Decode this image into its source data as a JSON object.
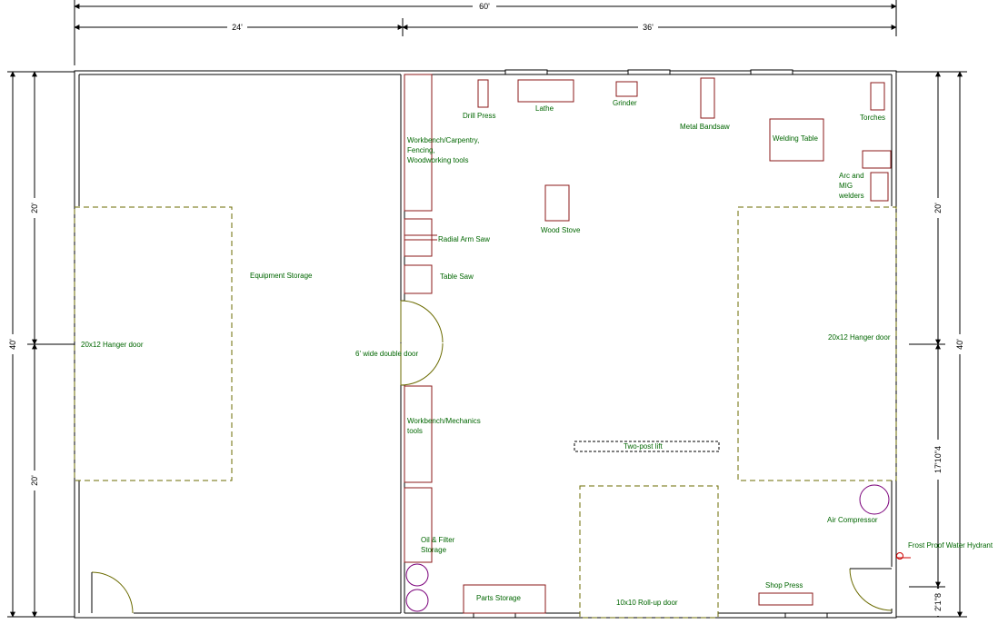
{
  "colors": {
    "wall": "#000000",
    "equipment": "#8b1a1a",
    "label": "#006600",
    "door": "#6b6b00",
    "hanger_dash": "#6b6b00",
    "circle": "#7a007a",
    "hydrant": "#cc0000"
  },
  "dimensions": {
    "total_width": "60'",
    "left_width": "24'",
    "right_width": "36'",
    "left_top_height": "20'",
    "left_total_height": "40'",
    "left_bottom_height": "20'",
    "right_top_height": "20'",
    "right_total_height": "40'",
    "right_mid_height": "17'10\"4",
    "right_bottom_height": "2'1\"8"
  },
  "labels": {
    "drill_press": "Drill Press",
    "lathe": "Lathe",
    "grinder": "Grinder",
    "metal_bandsaw": "Metal Bandsaw",
    "torches": "Torches",
    "welding_table": "Welding Table",
    "arc_mig": [
      "Arc and",
      "MIG",
      "welders"
    ],
    "workbench_carpentry": [
      "Workbench/Carpentry,",
      "Fencing,",
      "Woodworking tools"
    ],
    "radial_arm_saw": "Radial Arm Saw",
    "table_saw": "Table Saw",
    "wood_stove": "Wood Stove",
    "equipment_storage": "Equipment Storage",
    "left_hanger_door": "20x12 Hanger door",
    "right_hanger_door": "20x12 Hanger door",
    "double_door": "6' wide double door",
    "workbench_mechanics": [
      "Workbench/Mechanics",
      "tools"
    ],
    "two_post_lift": "Two-post lift",
    "air_compressor": "Air Compressor",
    "hydrant": "Frost Proof Water Hydrant",
    "oil_filter": [
      "Oil & Filter",
      "Storage"
    ],
    "parts_storage": "Parts Storage",
    "rollup_door": "10x10 Roll-up door",
    "shop_press": "Shop Press"
  }
}
